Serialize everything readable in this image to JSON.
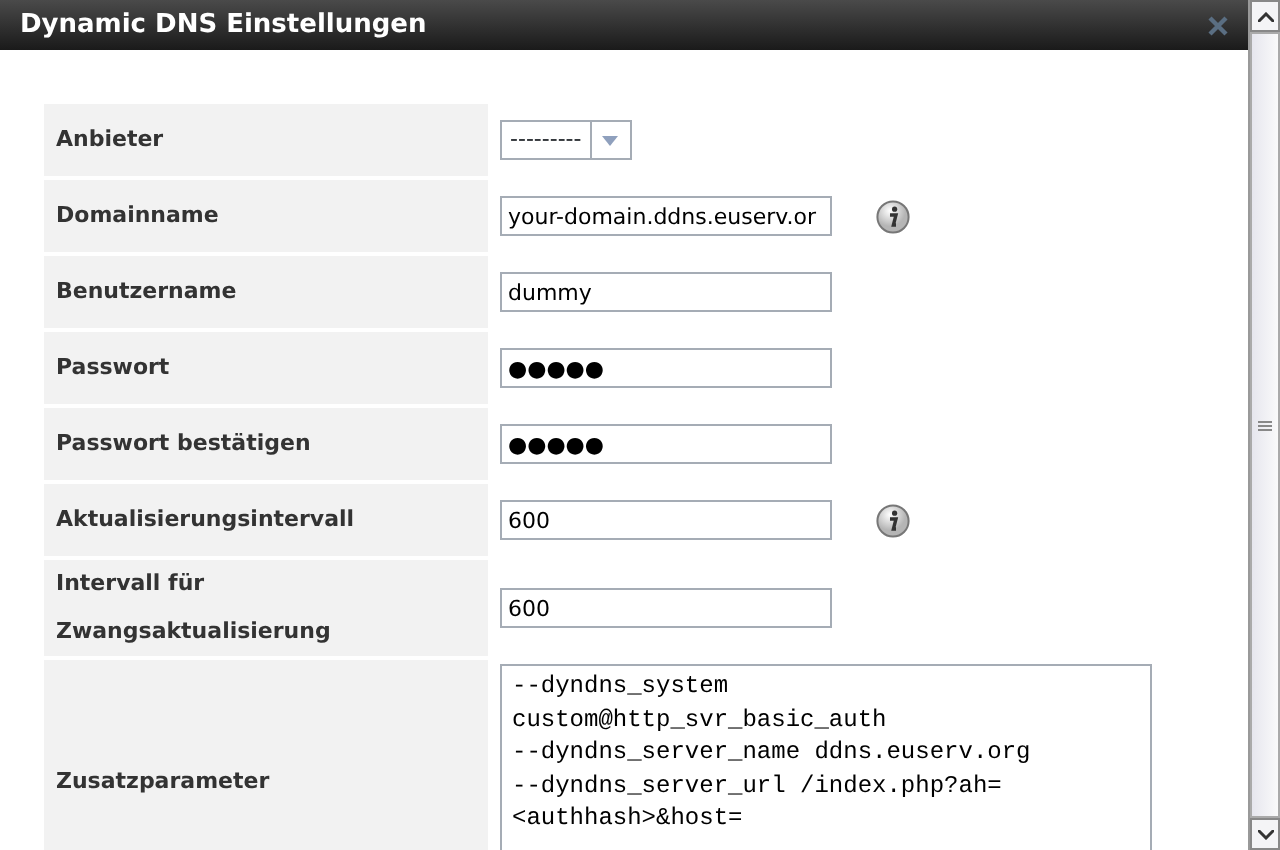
{
  "window": {
    "title": "Dynamic DNS Einstellungen"
  },
  "fields": [
    {
      "label": "Anbieter",
      "kind": "select",
      "value": "---------",
      "info": false
    },
    {
      "label": "Domainname",
      "kind": "text",
      "value": "your-domain.ddns.euserv.or",
      "info": true
    },
    {
      "label": "Benutzername",
      "kind": "text",
      "value": "dummy",
      "info": false
    },
    {
      "label": "Passwort",
      "kind": "password",
      "value": "●●●●●",
      "info": false
    },
    {
      "label": "Passwort bestätigen",
      "kind": "password",
      "value": "●●●●●",
      "info": false
    },
    {
      "label": "Aktualisierungsintervall",
      "kind": "text",
      "value": "600",
      "info": true
    },
    {
      "label": "Intervall für Zwangsaktualisierung",
      "kind": "text",
      "value": "600",
      "info": false
    },
    {
      "label": "Zusatzparameter",
      "kind": "textarea",
      "lines": [
        "--dyndns_system",
        "custom@http_svr_basic_auth",
        "--dyndns_server_name ddns.euserv.org",
        "--dyndns_server_url /index.php?ah=",
        "<authhash>&host="
      ],
      "info": false
    }
  ]
}
